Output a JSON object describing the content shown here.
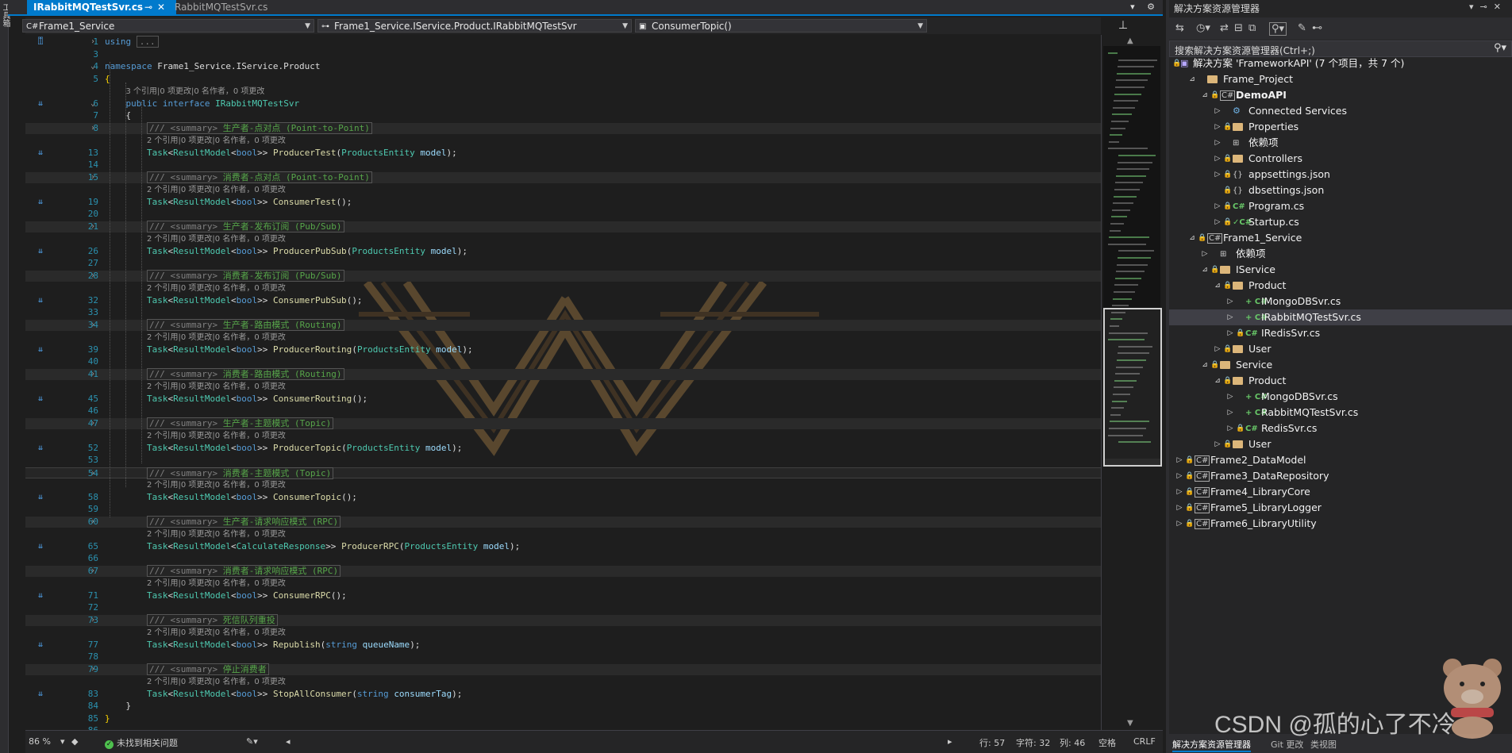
{
  "toolbox": {
    "label": "工具箱"
  },
  "tabs": [
    {
      "label": "IRabbitMQTestSvr.cs",
      "pin": "⊸",
      "close": "✕"
    },
    {
      "label": "RabbitMQTestSvr.cs"
    }
  ],
  "tabs_right": "▾ ⚙",
  "nav": {
    "project": "Frame1_Service",
    "type": "Frame1_Service.IService.Product.IRabbitMQTestSvr",
    "member": "ConsumerTopic()"
  },
  "editor": {
    "lens_text": "个引用|0 项更改|0 名作者，0 项更改",
    "interface_lens": "3 个引用|0 项更改|0 名作者，0 项更改",
    "method_lens": "2 个引用|0 项更改|0 名作者，0 项更改",
    "line_numbers": [
      "1",
      "3",
      "4",
      "5",
      "6",
      "7",
      "8",
      "13",
      "14",
      "15",
      "19",
      "20",
      "21",
      "26",
      "27",
      "28",
      "32",
      "33",
      "34",
      "39",
      "40",
      "41",
      "45",
      "46",
      "47",
      "52",
      "53",
      "54",
      "58",
      "59",
      "60",
      "65",
      "66",
      "67",
      "71",
      "72",
      "73",
      "77",
      "78",
      "79",
      "83",
      "84",
      "85",
      "86"
    ],
    "using_line": {
      "kw": "using",
      "collapsed": "..."
    },
    "namespace_line": {
      "kw": "namespace",
      "name": "Frame1_Service.IService.Product"
    },
    "interface_line": {
      "kw1": "public",
      "kw2": "interface",
      "name": "IRabbitMQTestSvr"
    },
    "methods": [
      {
        "summary": "生产者-点对点 (Point-to-Point)",
        "generic": "bool",
        "name": "ProducerTest",
        "params": "ProductsEntity model"
      },
      {
        "summary": "消费者-点对点 (Point-to-Point)",
        "generic": "bool",
        "name": "ConsumerTest",
        "params": ""
      },
      {
        "summary": "生产者-发布订阅 (Pub/Sub)",
        "generic": "bool",
        "name": "ProducerPubSub",
        "params": "ProductsEntity model"
      },
      {
        "summary": "消费者-发布订阅 (Pub/Sub)",
        "generic": "bool",
        "name": "ConsumerPubSub",
        "params": ""
      },
      {
        "summary": "生产者-路由模式 (Routing)",
        "generic": "bool",
        "name": "ProducerRouting",
        "params": "ProductsEntity model"
      },
      {
        "summary": "消费者-路由模式 (Routing)",
        "generic": "bool",
        "name": "ConsumerRouting",
        "params": ""
      },
      {
        "summary": "生产者-主题模式 (Topic)",
        "generic": "bool",
        "name": "ProducerTopic",
        "params": "ProductsEntity model"
      },
      {
        "summary": "消费者-主题模式 (Topic)",
        "generic": "bool",
        "name": "ConsumerTopic",
        "params": ""
      },
      {
        "summary": "生产者-请求响应模式 (RPC)",
        "generic": "CalculateResponse",
        "name": "ProducerRPC",
        "params": "ProductsEntity model"
      },
      {
        "summary": "消费者-请求响应模式 (RPC)",
        "generic": "bool",
        "name": "ConsumerRPC",
        "params": ""
      },
      {
        "summary": "死信队列重投",
        "generic": "bool",
        "name": "Republish",
        "params": "string queueName"
      },
      {
        "summary": "停止消费者",
        "generic": "bool",
        "name": "StopAllConsumer",
        "params": "string consumerTag"
      }
    ],
    "summary_prefix": "/// <summary>",
    "task_type": "Task",
    "result_type": "ResultModel"
  },
  "status": {
    "zoom": "86 %",
    "issues": "未找到相关问题",
    "line": "行: 57",
    "char": "字符: 32",
    "col": "列: 46",
    "spaces": "空格",
    "eol": "CRLF"
  },
  "solution_explorer": {
    "title": "解决方案资源管理器",
    "search_placeholder": "搜索解决方案资源管理器(Ctrl+;)",
    "solution": "解决方案 'FrameworkAPI' (7 个项目，共 7 个)",
    "items": [
      {
        "label": "Frame_Project",
        "kind": "folder"
      },
      {
        "label": "DemoAPI",
        "kind": "project"
      },
      {
        "label": "Connected Services",
        "kind": "service"
      },
      {
        "label": "Properties",
        "kind": "folder"
      },
      {
        "label": "依赖项",
        "kind": "deps"
      },
      {
        "label": "Controllers",
        "kind": "folder"
      },
      {
        "label": "appsettings.json",
        "kind": "json"
      },
      {
        "label": "dbsettings.json",
        "kind": "json"
      },
      {
        "label": "Program.cs",
        "kind": "cs"
      },
      {
        "label": "Startup.cs",
        "kind": "cs"
      },
      {
        "label": "Frame1_Service",
        "kind": "project"
      },
      {
        "label": "依赖项",
        "kind": "deps"
      },
      {
        "label": "IService",
        "kind": "folder"
      },
      {
        "label": "Product",
        "kind": "folder"
      },
      {
        "label": "IMongoDBSvr.cs",
        "kind": "cs"
      },
      {
        "label": "IRabbitMQTestSvr.cs",
        "kind": "cs"
      },
      {
        "label": "IRedisSvr.cs",
        "kind": "cs"
      },
      {
        "label": "User",
        "kind": "folder"
      },
      {
        "label": "Service",
        "kind": "folder"
      },
      {
        "label": "Product",
        "kind": "folder"
      },
      {
        "label": "MongoDBSvr.cs",
        "kind": "cs"
      },
      {
        "label": "RabbitMQTestSvr.cs",
        "kind": "cs"
      },
      {
        "label": "RedisSvr.cs",
        "kind": "cs"
      },
      {
        "label": "User",
        "kind": "folder"
      },
      {
        "label": "Frame2_DataModel",
        "kind": "project"
      },
      {
        "label": "Frame3_DataRepository",
        "kind": "project"
      },
      {
        "label": "Frame4_LibraryCore",
        "kind": "project"
      },
      {
        "label": "Frame5_LibraryLogger",
        "kind": "project"
      },
      {
        "label": "Frame6_LibraryUtility",
        "kind": "project"
      }
    ],
    "bottom_tabs": [
      "解决方案资源管理器",
      "Git 更改",
      "类视图"
    ]
  },
  "watermark": "CSDN @孤的心了不冷",
  "colors": {
    "accent": "#007acc",
    "keyword": "#569cd6",
    "type": "#4ec9b0",
    "method": "#dcdcaa",
    "comment": "#57a64a",
    "linenum": "#2b91af"
  }
}
